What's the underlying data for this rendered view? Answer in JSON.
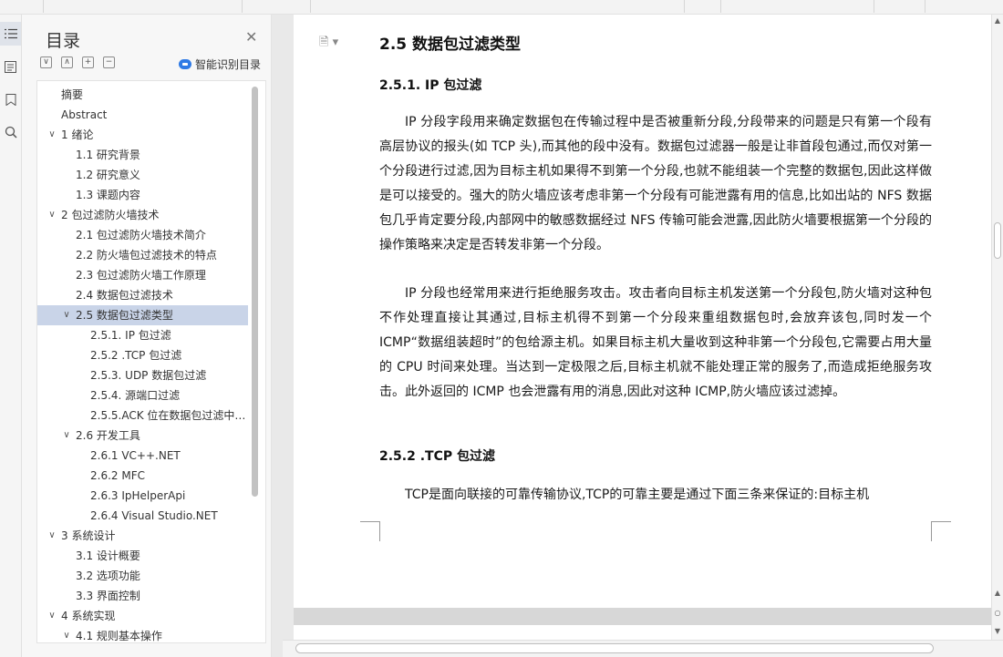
{
  "toc_panel": {
    "title": "目录",
    "smart_toc_label": "智能识别目录",
    "tools": [
      "∨",
      "∧",
      "+",
      "−"
    ],
    "items": [
      {
        "label": "摘要",
        "level": 0,
        "chevron": ""
      },
      {
        "label": "Abstract",
        "level": 0,
        "chevron": ""
      },
      {
        "label": "1  绪论",
        "level": 0,
        "chevron": "∨"
      },
      {
        "label": "1.1  研究背景",
        "level": 1,
        "chevron": ""
      },
      {
        "label": "1.2  研究意义",
        "level": 1,
        "chevron": ""
      },
      {
        "label": "1.3  课题内容",
        "level": 1,
        "chevron": ""
      },
      {
        "label": "2  包过滤防火墙技术",
        "level": 0,
        "chevron": "∨"
      },
      {
        "label": "2.1  包过滤防火墙技术简介",
        "level": 1,
        "chevron": ""
      },
      {
        "label": "2.2  防火墙包过滤技术的特点",
        "level": 1,
        "chevron": ""
      },
      {
        "label": "2.3  包过滤防火墙工作原理",
        "level": 1,
        "chevron": ""
      },
      {
        "label": "2.4  数据包过滤技术",
        "level": 1,
        "chevron": ""
      },
      {
        "label": "2.5  数据包过滤类型",
        "level": 1,
        "chevron": "∨",
        "selected": true
      },
      {
        "label": "2.5.1. IP 包过滤",
        "level": 2,
        "chevron": ""
      },
      {
        "label": "2.5.2 .TCP 包过滤",
        "level": 2,
        "chevron": ""
      },
      {
        "label": "2.5.3. UDP 数据包过滤",
        "level": 2,
        "chevron": ""
      },
      {
        "label": "2.5.4.  源端口过滤",
        "level": 2,
        "chevron": ""
      },
      {
        "label": "2.5.5.ACK 位在数据包过滤中的作用",
        "level": 2,
        "chevron": ""
      },
      {
        "label": "2.6 开发工具",
        "level": 1,
        "chevron": "∨"
      },
      {
        "label": "2.6.1 VC++.NET",
        "level": 2,
        "chevron": ""
      },
      {
        "label": "2.6.2 MFC",
        "level": 2,
        "chevron": ""
      },
      {
        "label": "2.6.3 IpHelperApi",
        "level": 2,
        "chevron": ""
      },
      {
        "label": "2.6.4 Visual Studio.NET",
        "level": 2,
        "chevron": ""
      },
      {
        "label": "3  系统设计",
        "level": 0,
        "chevron": "∨"
      },
      {
        "label": "3.1  设计概要",
        "level": 1,
        "chevron": ""
      },
      {
        "label": "3.2  选项功能",
        "level": 1,
        "chevron": ""
      },
      {
        "label": "3.3  界面控制",
        "level": 1,
        "chevron": ""
      },
      {
        "label": "4  系统实现",
        "level": 0,
        "chevron": "∨"
      },
      {
        "label": "4.1  规则基本操作",
        "level": 1,
        "chevron": "∨"
      }
    ]
  },
  "document": {
    "section_title": "2.5  数据包过滤类型",
    "sub1_title": "2.5.1. IP 包过滤",
    "para1": "IP 分段字段用来确定数据包在传输过程中是否被重新分段,分段带来的问题是只有第一个段有高层协议的报头(如 TCP 头),而其他的段中没有。数据包过滤器一般是让非首段包通过,而仅对第一个分段进行过滤,因为目标主机如果得不到第一个分段,也就不能组装一个完整的数据包,因此这样做是可以接受的。强大的防火墙应该考虑非第一个分段有可能泄露有用的信息,比如出站的 NFS 数据包几乎肯定要分段,内部网中的敏感数据经过 NFS 传输可能会泄露,因此防火墙要根据第一个分段的操作策略来决定是否转发非第一个分段。",
    "para2": "IP 分段也经常用来进行拒绝服务攻击。攻击者向目标主机发送第一个分段包,防火墙对这种包不作处理直接让其通过,目标主机得不到第一个分段来重组数据包时,会放弃该包,同时发一个 ICMP“数据组装超时”的包给源主机。如果目标主机大量收到这种非第一个分段包,它需要占用大量的 CPU 时间来处理。当达到一定极限之后,目标主机就不能处理正常的服务了,而造成拒绝服务攻击。此外返回的 ICMP 也会泄露有用的消息,因此对这种 ICMP,防火墙应该过滤掉。",
    "sub2_title": "2.5.2 .TCP 包过滤",
    "para3": "TCP是面向联接的可靠传输协议,TCP的可靠主要是通过下面三条来保证的:目标主机"
  }
}
